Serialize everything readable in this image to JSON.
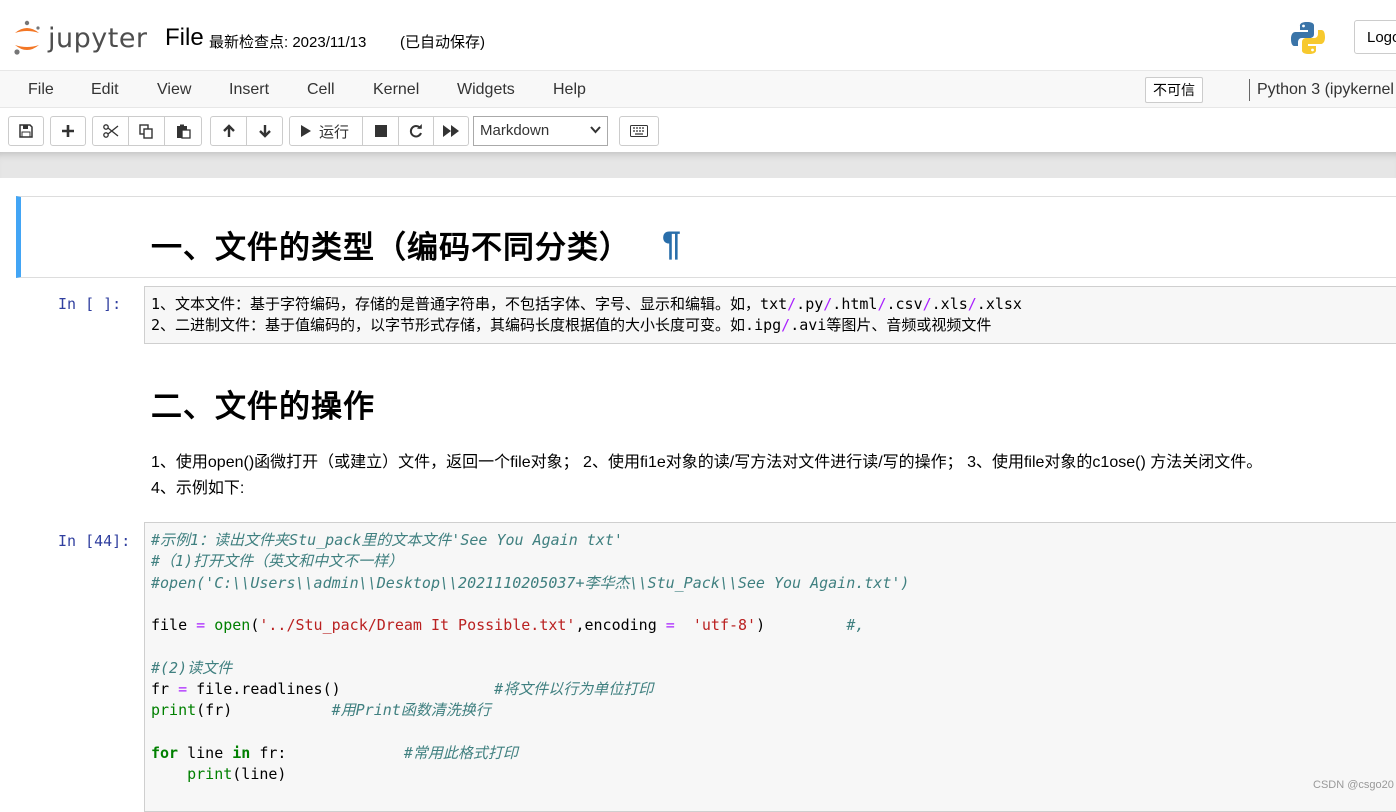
{
  "header": {
    "logo_text": "jupyter",
    "notebook_name": "File",
    "checkpoint": "最新检查点: 2023/11/13",
    "autosave": "(已自动保存)",
    "logout": "Logo"
  },
  "menubar": {
    "items": [
      "File",
      "Edit",
      "View",
      "Insert",
      "Cell",
      "Kernel",
      "Widgets",
      "Help"
    ],
    "trust": "不可信",
    "kernel": "Python 3 (ipykernel"
  },
  "toolbar": {
    "run_label": "运行",
    "cell_type": "Markdown",
    "icons": [
      "save-icon",
      "plus-icon",
      "scissors-icon",
      "copy-icon",
      "paste-icon",
      "arrow-up-icon",
      "arrow-down-icon",
      "run-icon",
      "stop-icon",
      "restart-icon",
      "fast-forward-icon",
      "keyboard-icon"
    ]
  },
  "cells": {
    "heading1": "一、文件的类型（编码不同分类）",
    "anchor": "¶",
    "raw_prompt": "In [ ]:",
    "raw_line1_a": "1、文本文件：基于字符编码，存储的是普通字符串，不包括字体、字号、显示和编辑。如，txt",
    "raw_line1_b": ".py",
    "raw_line1_c": ".html",
    "raw_line1_d": ".csv",
    "raw_line1_e": ".xls",
    "raw_line1_f": ".xlsx",
    "raw_line2_a": "2、二进制文件：基于值编码的，以字节形式存储，其编码长度根据值的大小长度可变。如.ipg",
    "raw_line2_b": ".avi等图片、音频或视频文件",
    "heading2": "二、文件的操作",
    "para_line1": "1、使用open()函微打开（或建立）文件，返回一个file对象；  2、使用fi1e对象的读/写方法对文件进行读/写的操作；  3、使用file对象的c1ose() 方法关闭文件。",
    "para_line2": "4、示例如下:",
    "code_prompt": "In [44]:",
    "code": {
      "c1": "#示例1：读出文件夹Stu_pack里的文本文件'See You Again txt'",
      "c2": "#（1)打开文件（英文和中文不一样）",
      "c3": "#open('C:\\\\Users\\\\admin\\\\Desktop\\\\2021110205037+李华杰\\\\Stu_Pack\\\\See You Again.txt')",
      "l4_file": "file ",
      "l4_eq": "=",
      "l4_open": "open",
      "l4_p1": "(",
      "l4_str": "'../Stu_pack/Dream It Possible.txt'",
      "l4_mid": ",encoding ",
      "l4_eq2": "=",
      "l4_sp": "  ",
      "l4_str2": "'utf-8'",
      "l4_p2": ")         ",
      "l4_cm": "#,",
      "c5": "#(2)读文件",
      "l6_a": "fr ",
      "l6_eq": "=",
      "l6_b": " file.readlines()                 ",
      "l6_cm": "#将文件以行为单位打印",
      "l7_print": "print",
      "l7_b": "(fr)           ",
      "l7_cm": "#用Print函数清洗换行",
      "l8_for": "for",
      "l8_b": " line ",
      "l8_in": "in",
      "l8_c": " fr:             ",
      "l8_cm": "#常用此格式打印",
      "l9_sp": "    ",
      "l9_print": "print",
      "l9_b": "(line)"
    }
  },
  "watermark": "CSDN @csgo20"
}
